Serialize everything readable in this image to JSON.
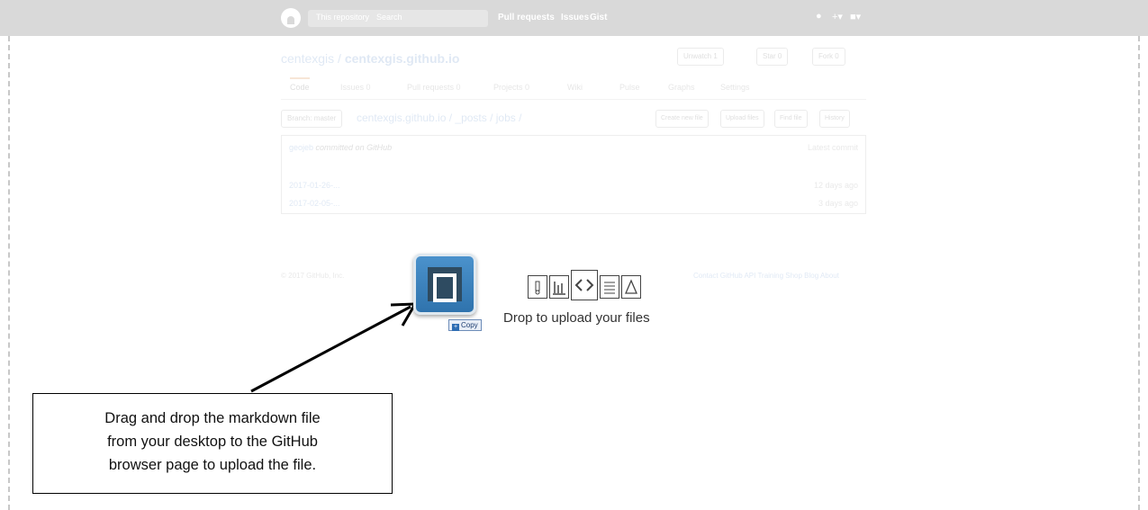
{
  "header": {
    "search_scope": "This repository",
    "search_placeholder": "Search",
    "nav": [
      "Pull requests",
      "Issues",
      "Gist"
    ],
    "notifications_icon": "bell-icon",
    "new_icon": "plus-icon",
    "user_icon": "user-icon"
  },
  "repo": {
    "owner": "centexgis",
    "separator": " / ",
    "name": "centexgis.github.io",
    "unwatch_label": "Unwatch",
    "unwatch_count": "1",
    "star_label": "Star",
    "star_count": "0",
    "fork_label": "Fork",
    "fork_count": "0",
    "tabs": [
      "Code",
      "Issues 0",
      "Pull requests 0",
      "Projects 0",
      "Wiki",
      "Pulse",
      "Graphs",
      "Settings"
    ],
    "branch_label": "Branch: master",
    "path": "centexgis.github.io / _posts / jobs /",
    "buttons": [
      "Create new file",
      "Upload files",
      "Find file",
      "History"
    ],
    "latest_commit": {
      "author": "geojeb",
      "message": "committed on GitHub",
      "meta": "Latest commit"
    },
    "files": [
      {
        "name": "2017-01-26-...",
        "age": "12 days ago"
      },
      {
        "name": "2017-02-05-...",
        "age": "3 days ago"
      }
    ],
    "footer_left": "© 2017 GitHub, Inc.",
    "footer_right": "Contact GitHub  API  Training  Shop  Blog  About"
  },
  "drag": {
    "copy_label": "Copy",
    "drop_text": "Drop to upload your files",
    "file_type_icons": [
      "archive-file-icon",
      "chart-file-icon",
      "code-file-icon",
      "text-file-icon",
      "pdf-file-icon"
    ]
  },
  "callout": {
    "lines": [
      "Drag and drop the markdown file",
      "from your desktop to the GitHub",
      "browser page to upload the file."
    ]
  }
}
